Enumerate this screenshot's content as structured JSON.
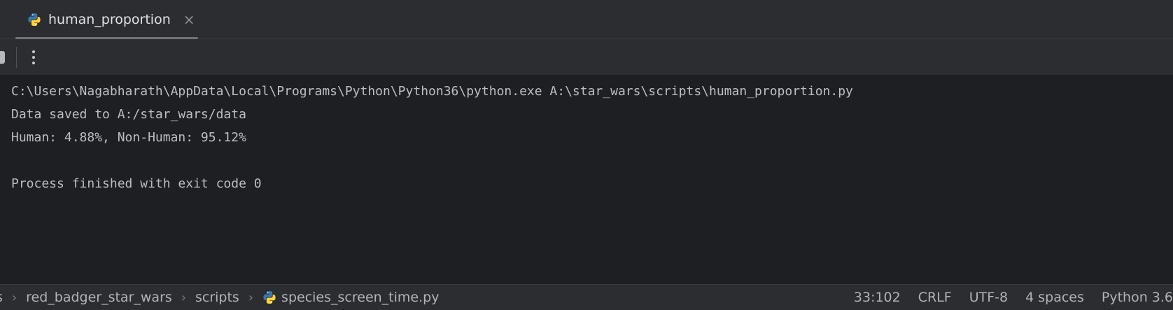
{
  "tab": {
    "icon": "python-file-icon",
    "label": "human_proportion",
    "close_glyph": "×"
  },
  "console": {
    "lines": [
      "C:\\Users\\Nagabharath\\AppData\\Local\\Programs\\Python\\Python36\\python.exe A:\\star_wars\\scripts\\human_proportion.py",
      "Data saved to A:/star_wars/data",
      "Human: 4.88%, Non-Human: 95.12%",
      "",
      "Process finished with exit code 0"
    ]
  },
  "statusbar": {
    "breadcrumbs": [
      "s",
      "red_badger_star_wars",
      "scripts"
    ],
    "file": "species_screen_time.py",
    "position": "33:102",
    "line_ending": "CRLF",
    "encoding": "UTF-8",
    "indent": "4 spaces",
    "interpreter": "Python 3.6"
  },
  "colors": {
    "background": "#1e1f22",
    "panel": "#2b2d30",
    "python_blue": "#3c78aa",
    "python_yellow": "#ffd43b"
  }
}
